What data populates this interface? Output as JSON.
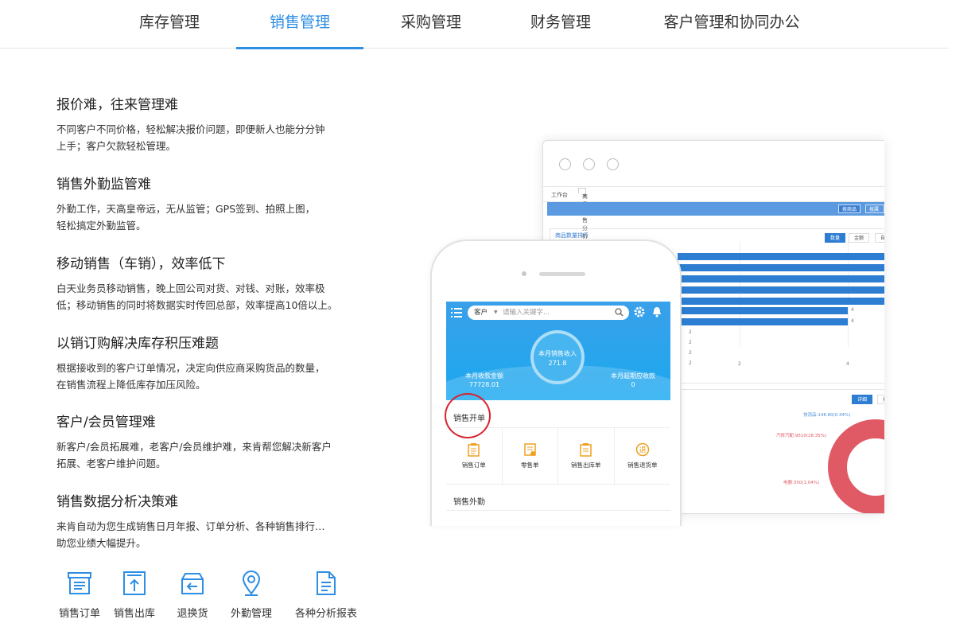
{
  "tabs": [
    {
      "label": "库存管理",
      "active": false
    },
    {
      "label": "销售管理",
      "active": true
    },
    {
      "label": "采购管理",
      "active": false
    },
    {
      "label": "财务管理",
      "active": false
    },
    {
      "label": "客户管理和协同办公",
      "active": false
    }
  ],
  "features": [
    {
      "title": "报价难，往来管理难",
      "desc1": "不同客户不同价格，轻松解决报价问题，即便新人也能分分钟",
      "desc2": "上手；客户欠款轻松管理。"
    },
    {
      "title": "销售外勤监管难",
      "desc1": "外勤工作，天高皇帝远，无从监管；GPS签到、拍照上图，",
      "desc2": "轻松搞定外勤监管。"
    },
    {
      "title": "移动销售（车销），效率低下",
      "desc1": "白天业务员移动销售，晚上回公司对货、对钱、对账，效率极",
      "desc2": "低；移动销售的同时将数据实时传回总部，效率提高10倍以上。"
    },
    {
      "title": "以销订购解决库存积压难题",
      "desc1": "根据接收到的客户订单情况，决定向供应商采购货品的数量，",
      "desc2": "在销售流程上降低库存加压风险。"
    },
    {
      "title": "客户/会员管理难",
      "desc1": "新客户/会员拓展难，老客户/会员维护难，来肯帮您解决新客户",
      "desc2": "拓展、老客户维护问题。"
    },
    {
      "title": "销售数据分析决策难",
      "desc1": "来肯自动为您生成销售日月年报、订单分析、各种销售排行…",
      "desc2": "助您业绩大幅提升。"
    }
  ],
  "icons": [
    {
      "label": "销售订单",
      "icon": "sales-order-icon"
    },
    {
      "label": "销售出库",
      "icon": "sales-outbound-icon"
    },
    {
      "label": "退换货",
      "icon": "return-exchange-icon"
    },
    {
      "label": "外勤管理",
      "icon": "location-pin-icon"
    },
    {
      "label": "各种分析报表",
      "icon": "report-document-icon"
    }
  ],
  "desktop": {
    "tab_home": "工作台",
    "tab_report": "商品销售分析",
    "tab_close": "×",
    "btn_by_goods": "按商品",
    "btn_by_attr": "按属性",
    "panel_title": "商品数量排行",
    "seg_qty": "数量",
    "seg_amount": "金额",
    "seg_more": "自",
    "axis": [
      "2",
      "4"
    ],
    "bar_label": "4",
    "small_values": [
      "2",
      "2",
      "2",
      "2"
    ],
    "btn_detail": "详细",
    "btn_more": "按",
    "pie_labels": [
      "快消品:148.80(0.44%)",
      "汽修汽配:9510(28.35%)",
      "电器:350(1.04%)"
    ]
  },
  "phone": {
    "search_scope": "客户",
    "search_placeholder": "请输入关键字...",
    "center_label": "本月销售收入",
    "center_value": "271.8",
    "left_label": "本月收款金额",
    "left_value": "77728.01",
    "right_label": "本月超期应收款",
    "right_value": "0",
    "section1": "销售开单",
    "menu": [
      "销售订单",
      "零售单",
      "销售出库单",
      "销售退货单"
    ],
    "section2": "销售外勤"
  },
  "colors": {
    "accent": "#2d8ee4",
    "phone_header": "#1aa9ef",
    "chart_bar": "#2d7dd2",
    "donut": "#e05a66",
    "highlight_circle": "#d9232d"
  }
}
